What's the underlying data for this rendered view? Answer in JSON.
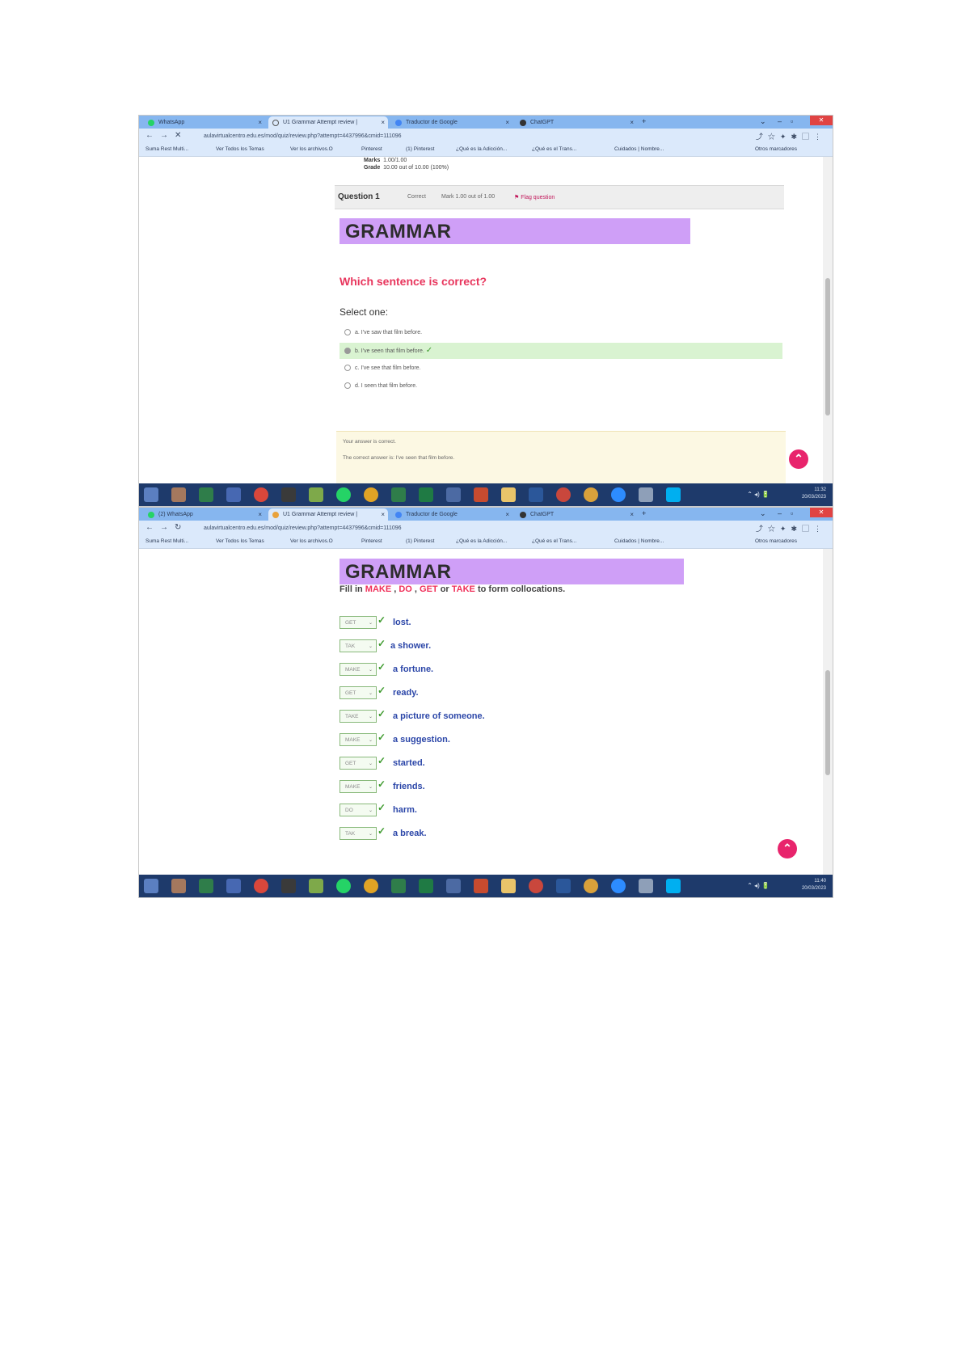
{
  "screenshot1": {
    "tabs": [
      {
        "label": "WhatsApp",
        "icon": "whatsapp-icon"
      },
      {
        "label": "U1 Grammar Attempt review |",
        "icon": "loading-icon"
      },
      {
        "label": "Traductor de Google",
        "icon": "translate-icon"
      },
      {
        "label": "ChatGPT",
        "icon": "chatgpt-icon"
      }
    ],
    "url": "aulavirtualcentro.edu.es/mod/quiz/review.php?attempt=4437996&cmid=111096",
    "bookmarks": [
      "Suma Rest Multi...",
      "Ver Todos los Temas",
      "Ver los archivos.O",
      "Pinterest",
      "(1) Pinterest",
      "¿Qué es la Adicción...",
      "¿Qué es el Trans...",
      "Cuidados | Nombre...",
      "Otros marcadores"
    ],
    "summary": {
      "marks_label": "Marks",
      "marks_value": "1.00/1.00",
      "grade_label": "Grade",
      "grade_value": "10.00 out of 10.00 (100%)"
    },
    "question": {
      "number": "Question 1",
      "state": "Correct",
      "mark": "Mark 1.00 out of 1.00",
      "flag": "Flag question"
    },
    "banner": "GRAMMAR",
    "prompt": "Which sentence is correct?",
    "select_label": "Select one:",
    "options": [
      {
        "letter": "a.",
        "text": "I've saw that film before.",
        "correct": false
      },
      {
        "letter": "b.",
        "text": "I've seen that film before.",
        "correct": true
      },
      {
        "letter": "c.",
        "text": "I've see that film before.",
        "correct": false
      },
      {
        "letter": "d.",
        "text": "I seen that film before.",
        "correct": false
      }
    ],
    "feedback": {
      "line1": "Your answer is correct.",
      "line2": "The correct answer is: I've seen that film before."
    },
    "clock": {
      "time": "11:32",
      "date": "20/03/2023"
    }
  },
  "screenshot2": {
    "tabs": [
      {
        "label": "(2) WhatsApp",
        "icon": "whatsapp-icon"
      },
      {
        "label": "U1 Grammar Attempt review |",
        "icon": "quiz-icon"
      },
      {
        "label": "Traductor de Google",
        "icon": "translate-icon"
      },
      {
        "label": "ChatGPT",
        "icon": "chatgpt-icon"
      }
    ],
    "url": "aulavirtualcentro.edu.es/mod/quiz/review.php?attempt=4437996&cmid=111096",
    "bookmarks": [
      "Suma Rest Multi...",
      "Ver Todos los Temas",
      "Ver los archivos.O",
      "Pinterest",
      "(1) Pinterest",
      "¿Qué es la Adicción...",
      "¿Qué es el Trans...",
      "Cuidados | Nombre...",
      "Otros marcadores"
    ],
    "banner": "GRAMMAR",
    "instruction": {
      "prefix": "Fill in ",
      "k1": "MAKE",
      "sep1": " , ",
      "k2": "DO",
      "sep2": " , ",
      "k3": "GET",
      "or": " or ",
      "k4": "TAKE",
      "suffix": " to form collocations."
    },
    "items": [
      {
        "answer": "GET",
        "phrase": "lost."
      },
      {
        "answer": "TAK",
        "phrase": "a shower."
      },
      {
        "answer": "MAKE",
        "phrase": "a fortune."
      },
      {
        "answer": "GET",
        "phrase": "ready."
      },
      {
        "answer": "TAKE",
        "phrase": "a picture of someone."
      },
      {
        "answer": "MAKE",
        "phrase": "a suggestion."
      },
      {
        "answer": "GET",
        "phrase": "started."
      },
      {
        "answer": "MAKE",
        "phrase": "friends."
      },
      {
        "answer": "DO",
        "phrase": "harm."
      },
      {
        "answer": "TAK",
        "phrase": "a break."
      }
    ],
    "clock": {
      "time": "11:40",
      "date": "20/03/2023"
    }
  }
}
